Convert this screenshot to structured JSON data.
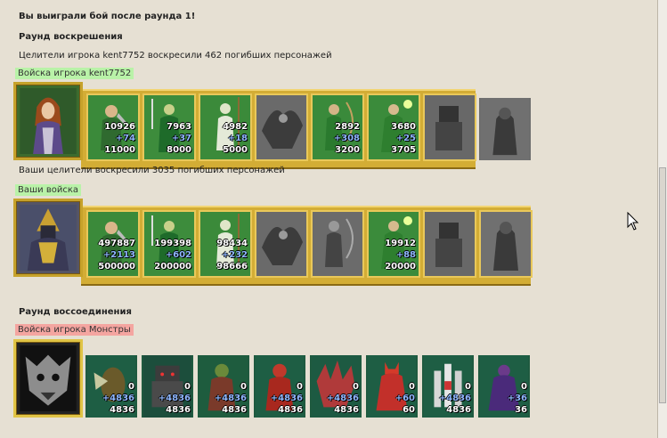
{
  "battle": {
    "result_heading": "Вы выиграли бой после раунда 1!",
    "resurrection_round_title": "Раунд воскрешения",
    "enemy_resurrection_text": "Целители игрока kent7752 воскресили 462 погибших персонажей",
    "player1_label": "Войска игрока kent7752",
    "your_resurrection_text": "Ваши целители воскресили 3035 погибших персонажей",
    "your_label": "Ваши войска",
    "reunion_round_title": "Раунд воссоединения",
    "monsters_label": "Войска игрока Монстры"
  },
  "colors": {
    "label_green": "#b9f2a8",
    "label_red": "#f4a5a0",
    "frame_gold": "#d3ad35",
    "gain_blue": "#8fb7ff"
  },
  "rows": {
    "kent": {
      "hero_icon": "elf-hero-portrait-icon",
      "units": [
        {
          "icon": "dwarf-unit-icon",
          "count": "10926",
          "gain": "+74",
          "total": "11000"
        },
        {
          "icon": "swordsman-unit-icon",
          "count": "7963",
          "gain": "+37",
          "total": "8000"
        },
        {
          "icon": "spearman-unit-icon",
          "count": "4982",
          "gain": "+18",
          "total": "5000"
        },
        {
          "icon": "griffin-unit-icon-dead",
          "count": "",
          "gain": "",
          "total": ""
        },
        {
          "icon": "archer-unit-icon",
          "count": "2892",
          "gain": "+308",
          "total": "3200"
        },
        {
          "icon": "druid-unit-icon",
          "count": "3680",
          "gain": "+25",
          "total": "3705"
        },
        {
          "icon": "golem-unit-icon-dead",
          "count": "",
          "gain": "",
          "total": ""
        },
        {
          "icon": "titan-unit-icon-dead",
          "count": "",
          "gain": "",
          "total": ""
        }
      ]
    },
    "yours": {
      "hero_icon": "knight-hero-portrait-icon",
      "units": [
        {
          "icon": "dwarf-unit-icon",
          "count": "497887",
          "gain": "+2113",
          "total": "500000"
        },
        {
          "icon": "swordsman-unit-icon",
          "count": "199398",
          "gain": "+602",
          "total": "200000"
        },
        {
          "icon": "spearman-unit-icon",
          "count": "98434",
          "gain": "+232",
          "total": "98666"
        },
        {
          "icon": "griffin-unit-icon-dead",
          "count": "",
          "gain": "",
          "total": ""
        },
        {
          "icon": "archer-unit-icon-dead",
          "count": "",
          "gain": "",
          "total": ""
        },
        {
          "icon": "druid-unit-icon",
          "count": "19912",
          "gain": "+88",
          "total": "20000"
        },
        {
          "icon": "golem-unit-icon-dead",
          "count": "",
          "gain": "",
          "total": ""
        },
        {
          "icon": "titan-unit-icon-dead",
          "count": "",
          "gain": "",
          "total": ""
        }
      ]
    },
    "monsters": {
      "hero_icon": "demon-mask-portrait-icon",
      "units": [
        {
          "icon": "wasp-unit-icon",
          "count": "0",
          "gain": "+4836",
          "total": "4836"
        },
        {
          "icon": "golem-monster-unit-icon",
          "count": "0",
          "gain": "+4836",
          "total": "4836"
        },
        {
          "icon": "orc-unit-icon",
          "count": "0",
          "gain": "+4836",
          "total": "4836"
        },
        {
          "icon": "red-demon-unit-icon",
          "count": "0",
          "gain": "+4836",
          "total": "4836"
        },
        {
          "icon": "spiked-beast-unit-icon",
          "count": "0",
          "gain": "+4836",
          "total": "4836"
        },
        {
          "icon": "red-devil-unit-icon",
          "count": "0",
          "gain": "+60",
          "total": "60"
        },
        {
          "icon": "castle-unit-icon",
          "count": "0",
          "gain": "+4836",
          "total": "4836"
        },
        {
          "icon": "purple-fiend-unit-icon",
          "count": "0",
          "gain": "+36",
          "total": "36"
        }
      ]
    }
  }
}
